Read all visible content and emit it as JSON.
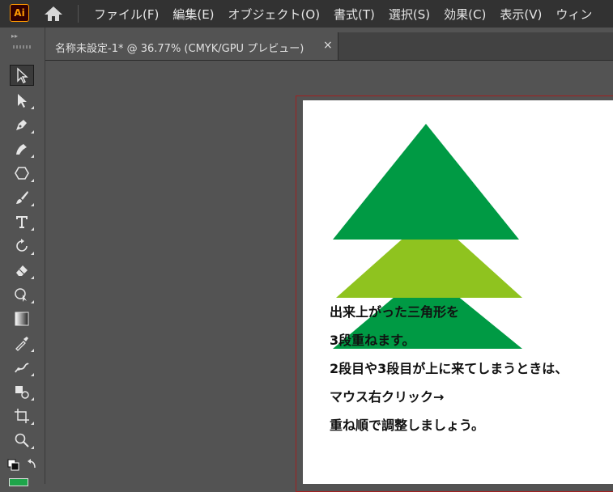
{
  "app": {
    "logo_text": "Ai"
  },
  "menu": {
    "items": [
      "ファイル(F)",
      "編集(E)",
      "オブジェクト(O)",
      "書式(T)",
      "選択(S)",
      "効果(C)",
      "表示(V)",
      "ウィン"
    ]
  },
  "toolbar": {
    "tools": [
      "selection",
      "direct-selection",
      "pen",
      "curvature",
      "shape",
      "paintbrush",
      "type",
      "rotate",
      "eraser",
      "shape-builder",
      "gradient",
      "eyedropper",
      "puppet-warp",
      "symbol-sprayer",
      "artboard",
      "zoom",
      "fill-stroke"
    ]
  },
  "document": {
    "tab_title": "名称未設定-1* @ 36.77% (CMYK/GPU プレビュー)",
    "close_glyph": "×"
  },
  "artwork": {
    "colors": {
      "top": "#009a44",
      "middle": "#8fc31f",
      "bottom": "#009a44"
    },
    "text_lines": [
      "出来上がった三角形を",
      "3段重ねます。",
      "2段目や3段目が上に来てしまうときは、",
      "マウス右クリック→",
      "重ね順で調整しましょう。"
    ]
  }
}
